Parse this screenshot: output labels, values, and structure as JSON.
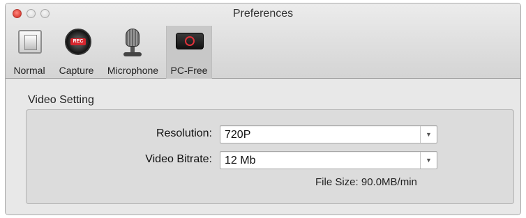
{
  "window": {
    "title": "Preferences"
  },
  "toolbar": {
    "items": [
      {
        "label": "Normal",
        "icon": "switch-icon"
      },
      {
        "label": "Capture",
        "icon": "rec-button-icon"
      },
      {
        "label": "Microphone",
        "icon": "microphone-icon"
      },
      {
        "label": "PC-Free",
        "icon": "capture-device-icon"
      }
    ],
    "selected": "PC-Free"
  },
  "video_setting": {
    "title": "Video Setting",
    "resolution": {
      "label": "Resolution:",
      "value": "720P"
    },
    "bitrate": {
      "label": "Video Bitrate:",
      "value": "12 Mb"
    },
    "file_size": "File Size: 90.0MB/min"
  },
  "colors": {
    "close": "#e0443b",
    "accent_red": "#d6262e"
  }
}
